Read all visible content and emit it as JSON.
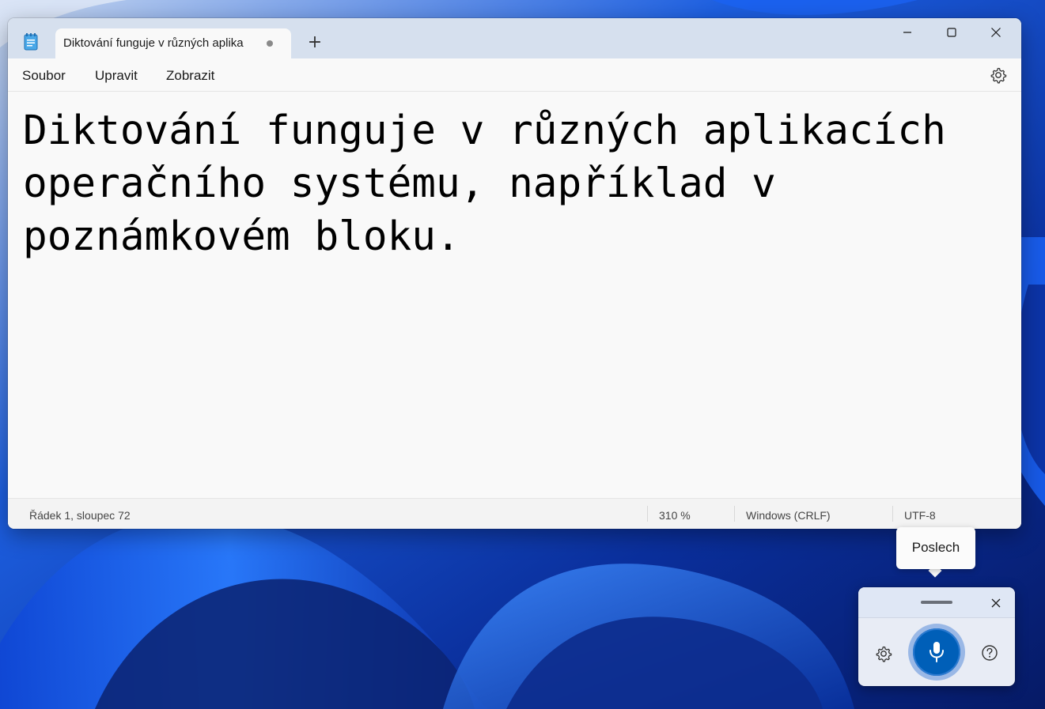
{
  "notepad": {
    "tab": {
      "title": "Diktování funguje v různých aplika",
      "unsaved_indicator": true
    },
    "new_tab_label": "+",
    "menu": {
      "file": "Soubor",
      "edit": "Upravit",
      "view": "Zobrazit"
    },
    "editor": {
      "text": "Diktování funguje v různých aplikacích operačního systému, například v poznámkovém bloku."
    },
    "status": {
      "position": "Řádek 1, sloupec 72",
      "zoom": "310 %",
      "line_ending": "Windows (CRLF)",
      "encoding": "UTF-8"
    }
  },
  "voice_typing": {
    "tooltip": "Poslech",
    "state": "listening",
    "accent_color": "#005fb8"
  },
  "icons": {
    "app": "notepad-icon",
    "minimize": "minimize-icon",
    "maximize": "maximize-icon",
    "close": "close-icon",
    "settings": "gear-icon",
    "microphone": "microphone-icon",
    "help": "help-icon"
  }
}
